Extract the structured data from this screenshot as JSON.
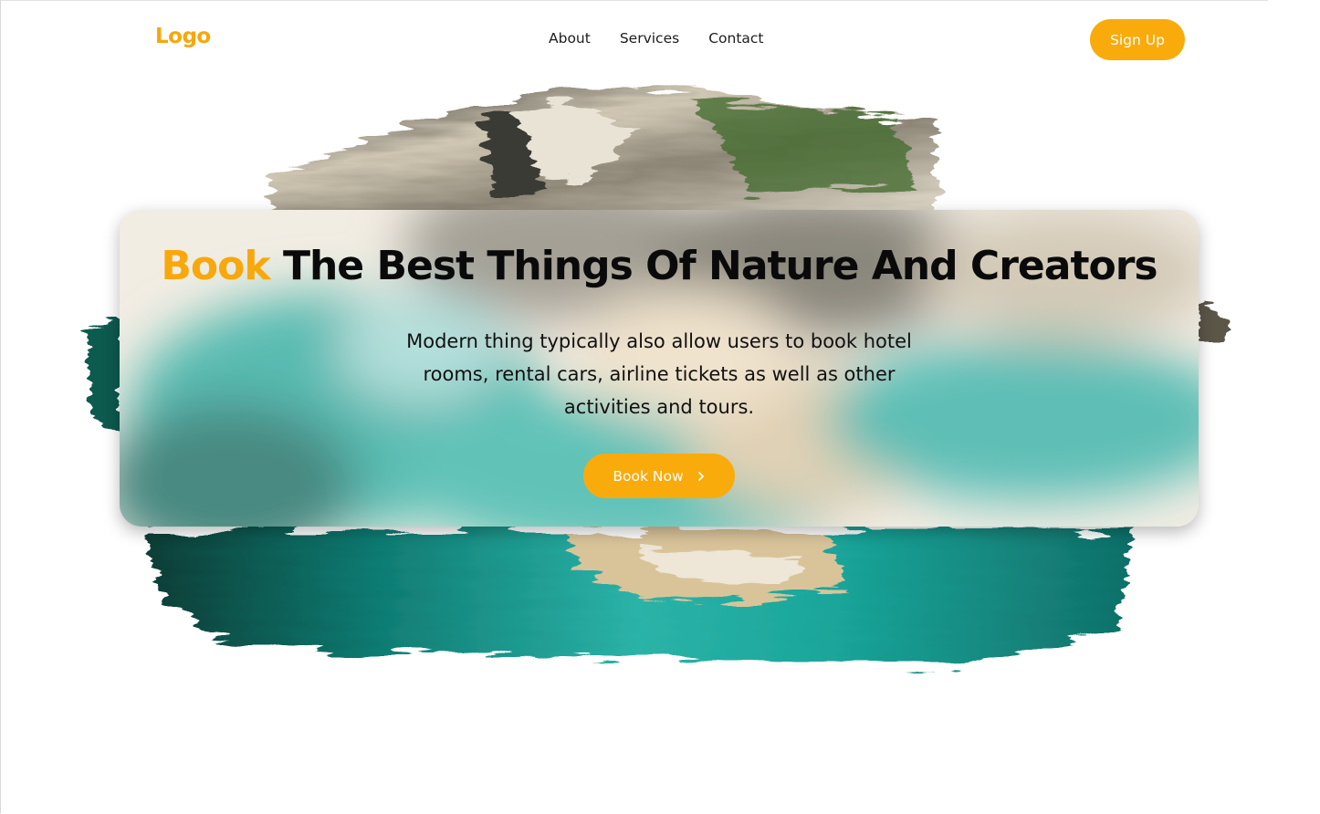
{
  "header": {
    "logo": "Logo",
    "nav": [
      {
        "label": "About"
      },
      {
        "label": "Services"
      },
      {
        "label": "Contact"
      }
    ],
    "signup_label": "Sign Up"
  },
  "hero": {
    "headline_accent": "Book",
    "headline_rest": "The Best Things Of Nature And Creators",
    "subtext": "Modern thing typically also allow users to book hotel rooms, rental cars, airline tickets as well as other activities and tours.",
    "cta_label": "Book Now",
    "cta_icon": "chevron-right-icon"
  },
  "colors": {
    "accent": "#f9ab0c",
    "text": "#0a0a0a",
    "background": "#ffffff",
    "sea": "#13948a"
  }
}
